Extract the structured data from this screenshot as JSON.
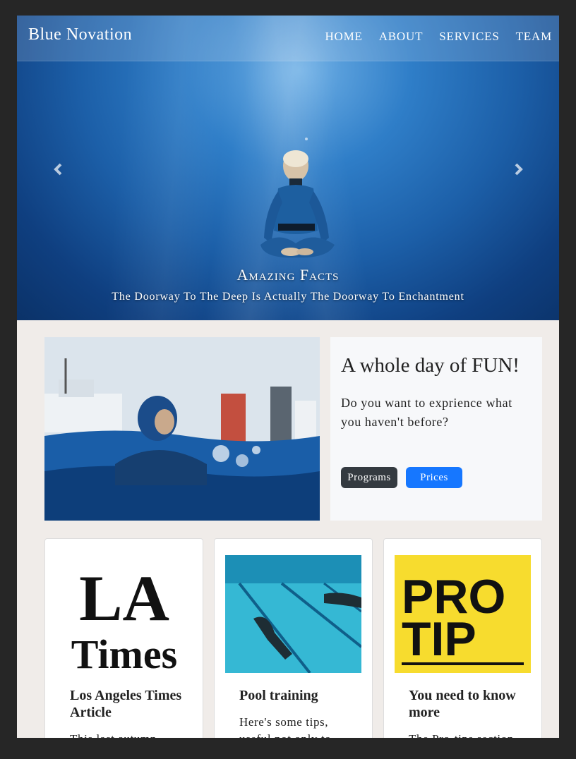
{
  "brand": "Blue Novation",
  "nav": [
    "HOME",
    "ABOUT",
    "SERVICES",
    "TEAM"
  ],
  "hero": {
    "caption_title": "Amazing Facts",
    "caption_subtitle": "The Doorway To The Deep Is Actually The Doorway To Enchantment",
    "prev_icon": "chevron-left-icon",
    "next_icon": "chevron-right-icon"
  },
  "feature": {
    "title": "A whole day of FUN!",
    "text": "Do you want to exprience what you haven't before?",
    "buttons": [
      "Programs",
      "Prices"
    ]
  },
  "cards": [
    {
      "title": "Los Angeles Times Article",
      "text": "This last autumn",
      "logo_top": "LA",
      "logo_bottom": "Times"
    },
    {
      "title": "Pool training",
      "text": "Here's some tips, useful not only to"
    },
    {
      "title": "You need to know more",
      "text": "The Pro-tips section",
      "logo_top": "PRO",
      "logo_bottom": "TIP"
    }
  ],
  "colors": {
    "accent": "#1677ff",
    "dark_button": "#343a40",
    "protip_yellow": "#f7dc2e"
  }
}
